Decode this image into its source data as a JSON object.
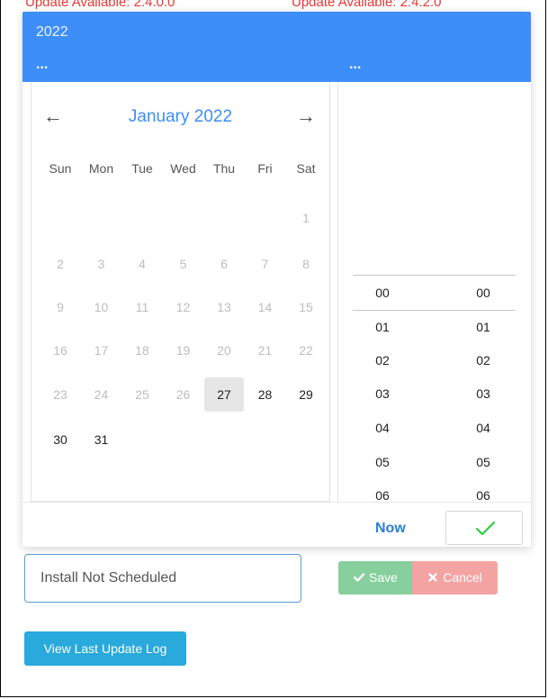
{
  "background_notices": {
    "left": "Update Available: 2.4.0.0",
    "right": "Update Available: 2.4.2.0"
  },
  "picker": {
    "header": {
      "year": "2022",
      "date_dots": "...",
      "time_dots": "..."
    },
    "calendar": {
      "prev_icon": "←",
      "next_icon": "→",
      "month": "January",
      "year": "2022",
      "weekdays": [
        "Sun",
        "Mon",
        "Tue",
        "Wed",
        "Thu",
        "Fri",
        "Sat"
      ],
      "days": [
        [
          "",
          "",
          "",
          "",
          "",
          "",
          "1"
        ],
        [
          "2",
          "3",
          "4",
          "5",
          "6",
          "7",
          "8"
        ],
        [
          "9",
          "10",
          "11",
          "12",
          "13",
          "14",
          "15"
        ],
        [
          "16",
          "17",
          "18",
          "19",
          "20",
          "21",
          "22"
        ],
        [
          "23",
          "24",
          "25",
          "26",
          "27",
          "28",
          "29"
        ],
        [
          "30",
          "31",
          "",
          "",
          "",
          "",
          ""
        ]
      ],
      "selected_day": "27"
    },
    "time": {
      "hours": [
        "00",
        "01",
        "02",
        "03",
        "04",
        "05",
        "06"
      ],
      "minutes": [
        "00",
        "01",
        "02",
        "03",
        "04",
        "05",
        "06"
      ]
    },
    "footer": {
      "now_label": "Now",
      "ok_icon": "check-icon"
    }
  },
  "form": {
    "install_value": "Install Not Scheduled",
    "save_label": "Save",
    "cancel_label": "Cancel",
    "view_log_label": "View Last Update Log"
  },
  "colors": {
    "header_blue": "#3d8ef8",
    "accent_blue": "#2a7fd4",
    "save_green": "#87cf9d",
    "cancel_red": "#f4a3a3",
    "log_blue": "#29a9dc",
    "check_green": "#2ecc40",
    "notice_red": "#e53935"
  }
}
